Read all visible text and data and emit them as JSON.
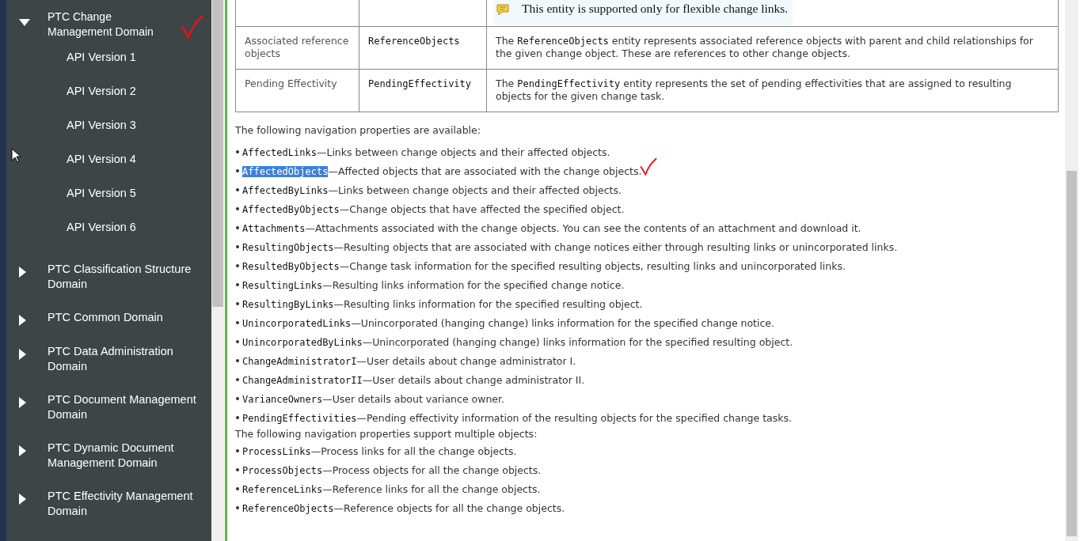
{
  "sidebar": {
    "items": [
      {
        "label": "PTC Change Management Domain",
        "expanded": true,
        "annotated": true,
        "children": [
          {
            "label": "API Version 1"
          },
          {
            "label": "API Version 2"
          },
          {
            "label": "API Version 3"
          },
          {
            "label": "API Version 4"
          },
          {
            "label": "API Version 5"
          },
          {
            "label": "API Version 6"
          }
        ]
      },
      {
        "label": "PTC Classification Structure Domain",
        "expanded": false,
        "annotated": false
      },
      {
        "label": "PTC Common Domain",
        "expanded": false,
        "annotated": false
      },
      {
        "label": "PTC Data Administration Domain",
        "expanded": false,
        "annotated": false
      },
      {
        "label": "PTC Document Management Domain",
        "expanded": false,
        "annotated": false
      },
      {
        "label": "PTC Dynamic Document Management Domain",
        "expanded": false,
        "annotated": false
      },
      {
        "label": "PTC Effectivity Management Domain",
        "expanded": false,
        "annotated": false
      }
    ]
  },
  "table": {
    "rows": [
      {
        "note": "This entity is supported only for flexible change links."
      },
      {
        "label": "Associated reference objects",
        "entity": "ReferenceObjects",
        "lead": "The ",
        "code": "ReferenceObjects",
        "rest": " entity represents associated reference objects with parent and child relationships for the given change object. These are references to other change objects."
      },
      {
        "label": "Pending Effectivity",
        "entity": "PendingEffectivity",
        "lead": "The ",
        "code": "PendingEffectivity",
        "rest": " entity represents the set of pending effectivities that are assigned to resulting objects for the given change task."
      }
    ]
  },
  "sections": [
    {
      "intro": "The following navigation properties are available:",
      "properties": [
        {
          "name": "AffectedLinks",
          "description": "—Links between change objects and their affected objects.",
          "selected": false,
          "annotated": false
        },
        {
          "name": "AffectedObjects",
          "description": "—Affected objects that are associated with the change objects.",
          "selected": true,
          "annotated": true
        },
        {
          "name": "AffectedByLinks",
          "description": "—Links between change objects and their affected objects.",
          "selected": false,
          "annotated": false
        },
        {
          "name": "AffectedByObjects",
          "description": "—Change objects that have affected the specified object.",
          "selected": false,
          "annotated": false
        },
        {
          "name": "Attachments",
          "description": "—Attachments associated with the change objects. You can see the contents of an attachment and download it.",
          "selected": false,
          "annotated": false
        },
        {
          "name": "ResultingObjects",
          "description": "—Resulting objects that are associated with change notices either through resulting links or unincorporated links.",
          "selected": false,
          "annotated": false
        },
        {
          "name": "ResultedByObjects",
          "description": "—Change task information for the specified resulting objects, resulting links and unincorporated links.",
          "selected": false,
          "annotated": false
        },
        {
          "name": "ResultingLinks",
          "description": "—Resulting links information for the specified change notice.",
          "selected": false,
          "annotated": false
        },
        {
          "name": "ResultingByLinks",
          "description": "—Resulting links information for the specified resulting object.",
          "selected": false,
          "annotated": false
        },
        {
          "name": "UnincorporatedLinks",
          "description": "—Unincorporated (hanging change) links information for the specified change notice.",
          "selected": false,
          "annotated": false
        },
        {
          "name": "UnincorporatedByLinks",
          "description": "—Unincorporated (hanging change) links information for the specified resulting object.",
          "selected": false,
          "annotated": false
        },
        {
          "name": "ChangeAdministratorI",
          "description": "—User details about change administrator I.",
          "selected": false,
          "annotated": false
        },
        {
          "name": "ChangeAdministratorII",
          "description": "—User details about change administrator II.",
          "selected": false,
          "annotated": false
        },
        {
          "name": "VarianceOwners",
          "description": "—User details about variance owner.",
          "selected": false,
          "annotated": false
        },
        {
          "name": "PendingEffectivities",
          "description": "—Pending effectivity information of the resulting objects for the specified change tasks.",
          "selected": false,
          "annotated": false
        }
      ]
    },
    {
      "intro": "The following navigation properties support multiple objects:",
      "properties": [
        {
          "name": "ProcessLinks",
          "description": "—Process links for all the change objects.",
          "selected": false,
          "annotated": false
        },
        {
          "name": "ProcessObjects",
          "description": "—Process objects for all the change objects.",
          "selected": false,
          "annotated": false
        },
        {
          "name": "ReferenceLinks",
          "description": "—Reference links for all the change objects.",
          "selected": false,
          "annotated": false
        },
        {
          "name": "ReferenceObjects",
          "description": "—Reference objects for all the change objects.",
          "selected": false,
          "annotated": false
        }
      ]
    }
  ]
}
